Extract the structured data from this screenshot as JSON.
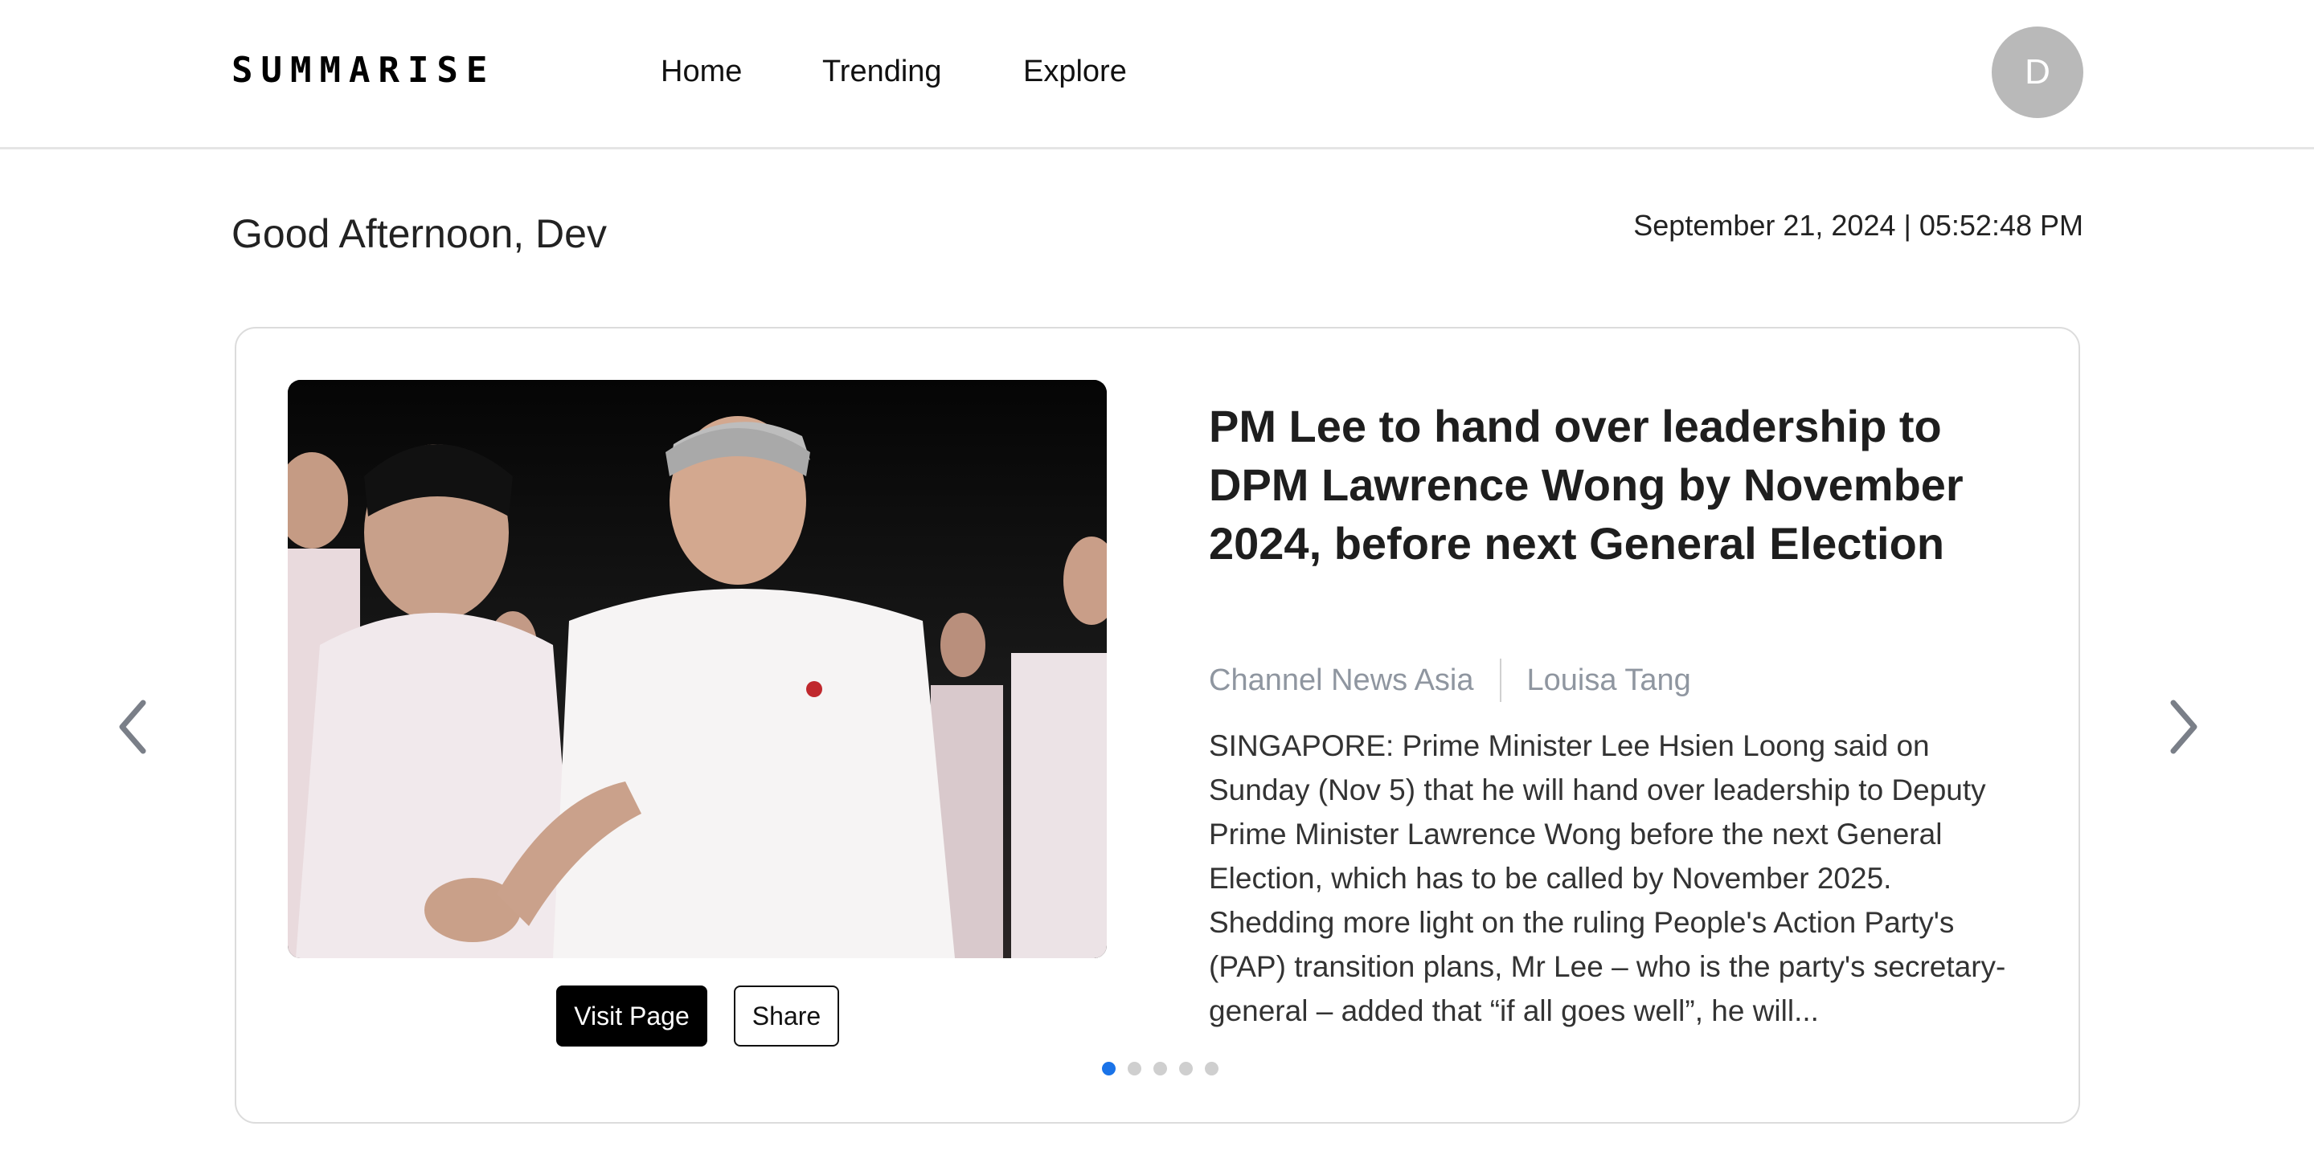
{
  "header": {
    "logo": "SUMMARISE",
    "nav": [
      {
        "label": "Home"
      },
      {
        "label": "Trending"
      },
      {
        "label": "Explore"
      }
    ],
    "avatar_initial": "D"
  },
  "greeting": "Good Afternoon, Dev",
  "datetime": "September 21, 2024 | 05:52:48 PM",
  "carousel": {
    "article": {
      "title": "PM Lee to hand over leadership to DPM Lawrence Wong by November 2024, before next General Election",
      "source": "Channel News Asia",
      "author": "Louisa Tang",
      "summary": "SINGAPORE: Prime Minister Lee Hsien Loong said on Sunday (Nov 5) that he will hand over leadership to Deputy Prime Minister Lawrence Wong before the next General Election, which has to be called by November 2025. Shedding more light on the ruling People's Action Party's (PAP) transition plans, Mr Lee – who is the party's secretary-general – added that “if all goes well”, he will...",
      "image_icon": "news-photo-image"
    },
    "buttons": {
      "visit": "Visit Page",
      "share": "Share"
    },
    "slide_count": 5,
    "active_slide": 1
  },
  "icons": {
    "prev": "chevron-left-icon",
    "next": "chevron-right-icon"
  },
  "colors": {
    "accent": "#1a73e8",
    "primary_button": "#000000",
    "avatar_bg": "#b9b9b9",
    "meta_text": "#8f96a0"
  }
}
